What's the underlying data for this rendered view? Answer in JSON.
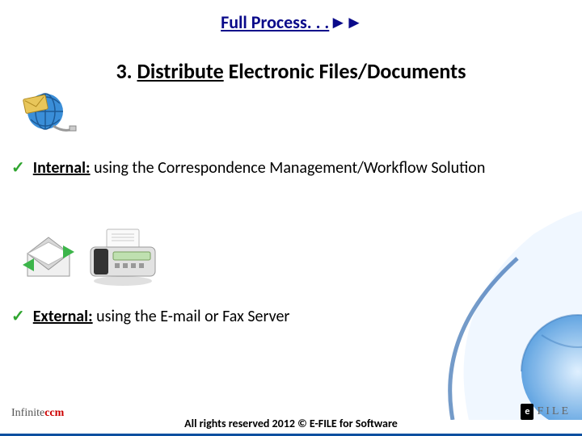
{
  "title": {
    "main": "Full Process. . .",
    "arrows": "►►"
  },
  "subtitle": {
    "num": "3. ",
    "highlight": "Distribute",
    "rest": " Electronic Files/Documents"
  },
  "bullets": [
    {
      "label": "Internal:",
      "desc": " using the Correspondence Management/Workflow Solution"
    },
    {
      "label": "External:",
      "desc": " using the E-mail or Fax Server"
    }
  ],
  "footer": "All rights reserved 2012 © E-FILE for Software",
  "logos": {
    "left_a": "Infinite",
    "left_b": "ccm",
    "right_box": "e",
    "right_text": "FILE"
  },
  "icons": {
    "globe": "globe-email-icon",
    "envelope": "envelope-icon",
    "fax": "fax-machine-icon"
  }
}
